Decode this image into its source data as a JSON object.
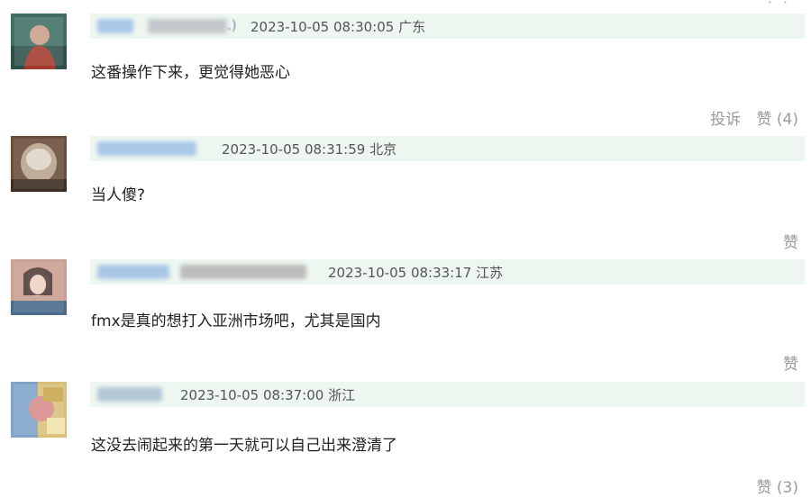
{
  "comments": [
    {
      "username_tail": ".)",
      "datetime": "2023-10-05 08:30:05",
      "location": "广东",
      "text": "这番操作下来，更觉得她恶心",
      "report_label": "投诉",
      "like_label": "赞 (4)"
    },
    {
      "username_tail": "",
      "datetime": "2023-10-05 08:31:59",
      "location": "北京",
      "text": "当人傻?",
      "report_label": "",
      "like_label": "赞"
    },
    {
      "username_tail": "",
      "datetime": "2023-10-05 08:33:17",
      "location": "江苏",
      "text": "fmx是真的想打入亚洲市场吧，尤其是国内",
      "report_label": "",
      "like_label": "赞"
    },
    {
      "username_tail": "",
      "datetime": "2023-10-05 08:37:00",
      "location": "浙江",
      "text": "这没去闹起来的第一天就可以自己出来澄清了",
      "report_label": "",
      "like_label": "赞 (3)"
    }
  ],
  "colors": {
    "header_bg": "#eef6f0",
    "meta_text": "#555555",
    "action_text": "#9a9a9a"
  }
}
